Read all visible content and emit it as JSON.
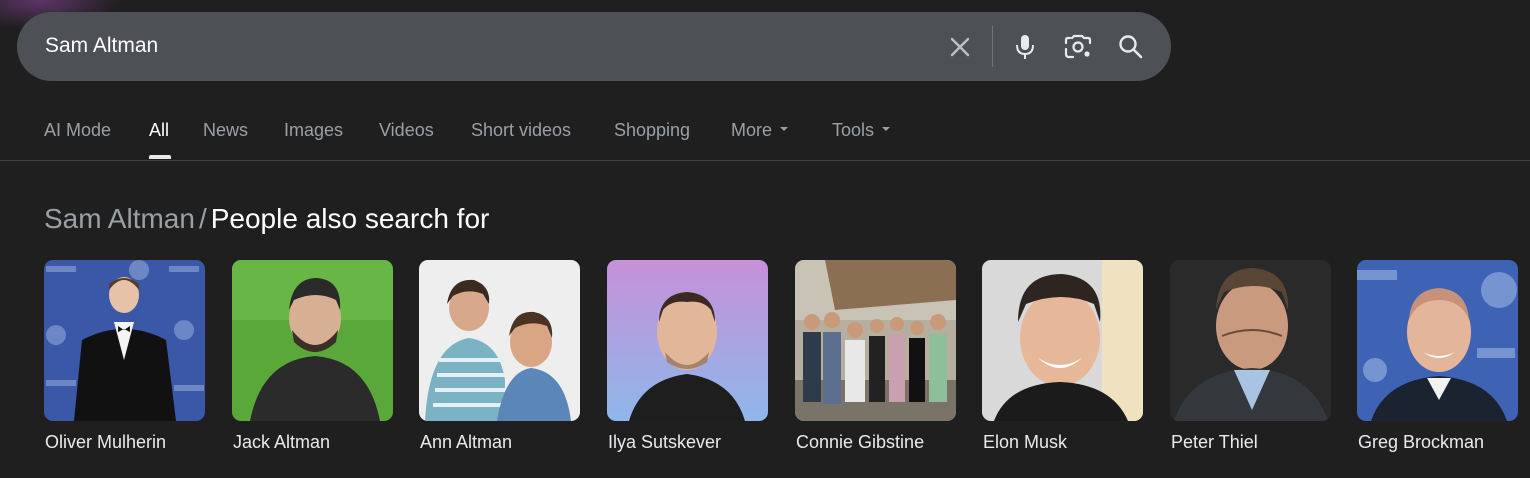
{
  "search": {
    "query": "Sam Altman",
    "clear_icon": "close-icon",
    "voice_icon": "microphone-icon",
    "lens_icon": "lens-camera-icon",
    "search_icon": "search-icon"
  },
  "tabs": [
    {
      "label": "AI Mode",
      "active": false
    },
    {
      "label": "All",
      "active": true
    },
    {
      "label": "News",
      "active": false
    },
    {
      "label": "Images",
      "active": false
    },
    {
      "label": "Videos",
      "active": false
    },
    {
      "label": "Short videos",
      "active": false
    },
    {
      "label": "Shopping",
      "active": false
    },
    {
      "label": "More",
      "active": false,
      "has_dropdown": true
    },
    {
      "label": "Tools",
      "active": false,
      "has_dropdown": true
    }
  ],
  "section": {
    "breadcrumb": "Sam Altman",
    "separator": "/",
    "title": "People also search for"
  },
  "people": [
    {
      "name": "Oliver Mulherin"
    },
    {
      "name": "Jack Altman"
    },
    {
      "name": "Ann Altman"
    },
    {
      "name": "Ilya Sutskever"
    },
    {
      "name": "Connie Gibstine"
    },
    {
      "name": "Elon Musk"
    },
    {
      "name": "Peter Thiel"
    },
    {
      "name": "Greg Brockman"
    }
  ],
  "colors": {
    "background": "#1f1f1f",
    "searchbar": "#4d5156",
    "text_primary": "#e8eaed",
    "text_secondary": "#9aa0a6"
  }
}
